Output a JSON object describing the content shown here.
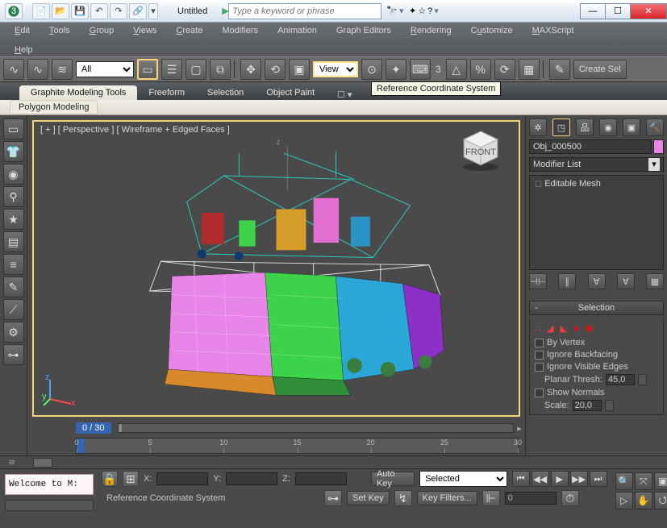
{
  "title": "Untitled",
  "search": {
    "placeholder": "Type a keyword or phrase"
  },
  "menus": {
    "edit": "Edit",
    "tools": "Tools",
    "group": "Group",
    "views": "Views",
    "create": "Create",
    "modifiers": "Modifiers",
    "animation": "Animation",
    "graph": "Graph Editors",
    "rendering": "Rendering",
    "customize": "Customize",
    "maxscript": "MAXScript",
    "help": "Help"
  },
  "toolbar": {
    "filter_all": "All",
    "coord_system": "View",
    "tooltip": "Reference Coordinate System",
    "seltag": "3",
    "create_sel": "Create Sel"
  },
  "ribbon": {
    "tabs": {
      "graphite": "Graphite Modeling Tools",
      "freeform": "Freeform",
      "selection": "Selection",
      "object_paint": "Object Paint"
    },
    "subtab": "Polygon Modeling"
  },
  "viewport": {
    "label": "[ + ] [ Perspective ] [ Wireframe + Edged Faces ]",
    "cube_face": "FRONT",
    "axis_label": "z"
  },
  "timeline": {
    "frame_label": "0 / 30",
    "ticks": [
      "0",
      "5",
      "10",
      "15",
      "20",
      "25",
      "30"
    ]
  },
  "command_panel": {
    "obj_name": "Obj_000500",
    "obj_color": "#e985e8",
    "modifier_list_label": "Modifier List",
    "stack_item": "Editable Mesh",
    "rollout": {
      "title": "Selection",
      "by_vertex": "By Vertex",
      "ignore_backfacing": "Ignore Backfacing",
      "ignore_visible_edges": "Ignore Visible Edges",
      "planar_thresh_label": "Planar Thresh:",
      "planar_thresh_value": "45,0",
      "show_normals": "Show Normals",
      "scale_label": "Scale:",
      "scale_value": "20,0"
    }
  },
  "bottom": {
    "prompt": "Welcome to M:",
    "x_label": "X:",
    "y_label": "Y:",
    "z_label": "Z:",
    "auto_key": "Auto Key",
    "set_key": "Set Key",
    "selected_label": "Selected",
    "key_filters": "Key Filters...",
    "frame_value": "0",
    "status": "Reference Coordinate System"
  },
  "icons": {
    "lock": "🔒",
    "key": "⊶"
  }
}
